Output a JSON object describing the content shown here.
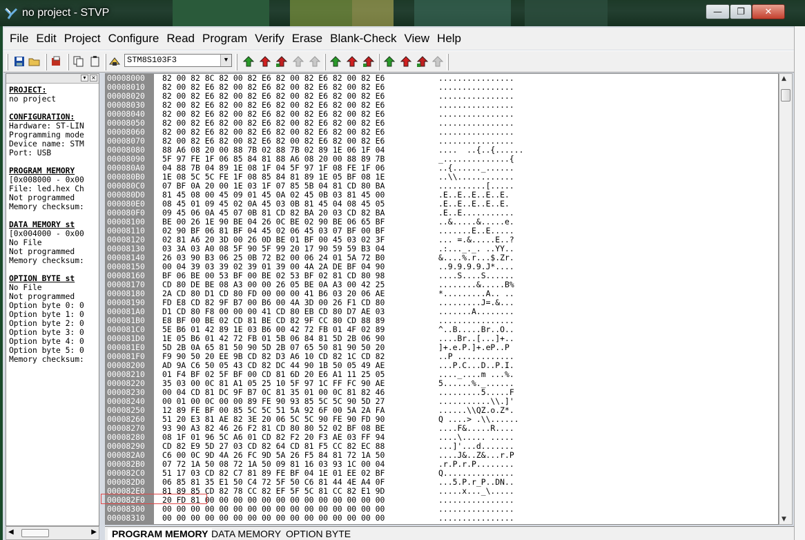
{
  "window": {
    "title": "no project - STVP",
    "min": "—",
    "max": "❐",
    "close": "✕"
  },
  "menu": [
    "File",
    "Edit",
    "Project",
    "Configure",
    "Read",
    "Program",
    "Verify",
    "Erase",
    "Blank-Check",
    "View",
    "Help"
  ],
  "toolbar": {
    "device": "STM8S103F3"
  },
  "left_panel": [
    {
      "t": "PROJECT:",
      "h": true
    },
    {
      "t": "no project"
    },
    {
      "t": ""
    },
    {
      "t": "CONFIGURATION:",
      "h": true
    },
    {
      "t": "Hardware: ST-LIN"
    },
    {
      "t": "Programming mode"
    },
    {
      "t": "Device name: STM"
    },
    {
      "t": "Port: USB"
    },
    {
      "t": ""
    },
    {
      "t": "PROGRAM MEMORY",
      "h": true
    },
    {
      "t": "[0x008000 - 0x00"
    },
    {
      "t": "File: led.hex Ch"
    },
    {
      "t": "Not programmed"
    },
    {
      "t": "Memory checksum:"
    },
    {
      "t": ""
    },
    {
      "t": "DATA MEMORY st",
      "h": true
    },
    {
      "t": "[0x004000 - 0x00"
    },
    {
      "t": "No File"
    },
    {
      "t": "Not programmed"
    },
    {
      "t": "Memory checksum:"
    },
    {
      "t": ""
    },
    {
      "t": "OPTION BYTE st",
      "h": true
    },
    {
      "t": "No File"
    },
    {
      "t": "Not programmed"
    },
    {
      "t": "Option byte 0: 0"
    },
    {
      "t": "Option byte 1: 0"
    },
    {
      "t": "Option byte 2: 0"
    },
    {
      "t": "Option byte 3: 0"
    },
    {
      "t": "Option byte 4: 0"
    },
    {
      "t": "Option byte 5: 0"
    },
    {
      "t": "Memory checksum:"
    }
  ],
  "hex_rows": [
    {
      "a": "00008000",
      "b": "82 00 82 8C 82 00 82 E6 82 00 82 E6 82 00 82 E6",
      "s": "................"
    },
    {
      "a": "00008010",
      "b": "82 00 82 E6 82 00 82 E6 82 00 82 E6 82 00 82 E6",
      "s": "................"
    },
    {
      "a": "00008020",
      "b": "82 00 82 E6 82 00 82 E6 82 00 82 E6 82 00 82 E6",
      "s": "................"
    },
    {
      "a": "00008030",
      "b": "82 00 82 E6 82 00 82 E6 82 00 82 E6 82 00 82 E6",
      "s": "................"
    },
    {
      "a": "00008040",
      "b": "82 00 82 E6 82 00 82 E6 82 00 82 E6 82 00 82 E6",
      "s": "................"
    },
    {
      "a": "00008050",
      "b": "82 00 82 E6 82 00 82 E6 82 00 82 E6 82 00 82 E6",
      "s": "................"
    },
    {
      "a": "00008060",
      "b": "82 00 82 E6 82 00 82 E6 82 00 82 E6 82 00 82 E6",
      "s": "................"
    },
    {
      "a": "00008070",
      "b": "82 00 82 E6 82 00 82 E6 82 00 82 E6 82 00 82 E6",
      "s": "................"
    },
    {
      "a": "00008080",
      "b": "88 A6 08 20 00 88 7B 02 88 7B 02 89 1E 06 1F 04",
      "s": "....  ..{..{......"
    },
    {
      "a": "00008090",
      "b": "5F 97 FE 1F 06 85 84 81 88 A6 08 20 00 88 89 7B",
      "s": "_..............{"
    },
    {
      "a": "000080A0",
      "b": "04 88 7B 04 89 1E 08 1F 04 5F 97 1F 08 FE 1F 06",
      "s": "..{......_......"
    },
    {
      "a": "000080B0",
      "b": "1E 08 5C 5C FE 1F 08 85 84 81 89 1E 05 BF 08 1E",
      "s": "..\\\\............"
    },
    {
      "a": "000080C0",
      "b": "07 BF 0A 20 00 1E 03 1F 07 85 5B 04 81 CD 80 BA",
      "s": "..........[....."
    },
    {
      "a": "000080D0",
      "b": "81 45 08 00 45 09 01 45 0A 02 45 0B 03 81 45 00",
      "s": ".E..E..E..E..E."
    },
    {
      "a": "000080E0",
      "b": "08 45 01 09 45 02 0A 45 03 0B 81 45 04 08 45 05",
      "s": ".E..E..E..E..E."
    },
    {
      "a": "000080F0",
      "b": "09 45 06 0A 45 07 0B 81 CD 82 BA 20 03 CD 82 BA",
      "s": ".E..E..........."
    },
    {
      "a": "00008100",
      "b": "BE 00 26 1E 90 BE 04 26 0C BE 02 90 BE 06 65 BF",
      "s": "..&.....&.....e."
    },
    {
      "a": "00008110",
      "b": "02 90 BF 06 81 BF 04 45 02 06 45 03 07 BF 00 BF",
      "s": ".......E..E....."
    },
    {
      "a": "00008120",
      "b": "02 81 A6 20 3D 00 26 0D BE 01 BF 00 45 03 02 3F",
      "s": "... =.&.....E..?"
    },
    {
      "a": "00008130",
      "b": "03 3A 03 A0 08 5F 90 5F 99 20 17 90 59 59 B3 04",
      "s": ".:..._._. ..YY.."
    },
    {
      "a": "00008140",
      "b": "26 03 90 B3 06 25 0B 72 B2 00 06 24 01 5A 72 B0",
      "s": "&....%.r...$.Zr."
    },
    {
      "a": "00008150",
      "b": "00 04 39 03 39 02 39 01 39 00 4A 2A DE BF 04 90",
      "s": "..9.9.9.9.J*...."
    },
    {
      "a": "00008160",
      "b": "BF 06 BE 00 53 BF 00 BE 02 53 BF 02 81 CD 80 98",
      "s": "....S....S......"
    },
    {
      "a": "00008170",
      "b": "CD 80 DE BE 08 A3 00 00 26 05 BE 0A A3 00 42 25",
      "s": "........&.....B%"
    },
    {
      "a": "00008180",
      "b": "2A CD 80 D1 CD 80 FD 00 00 00 41 B6 03 20 06 AE",
      "s": "*.........A.. .."
    },
    {
      "a": "00008190",
      "b": "FD E8 CD 82 9F B7 00 B6 00 4A 3D 00 26 F1 CD 80",
      "s": ".........J=.&..."
    },
    {
      "a": "000081A0",
      "b": "D1 CD 80 F8 00 00 00 41 CD 80 EB CD 80 D7 AE 03",
      "s": ".......A........"
    },
    {
      "a": "000081B0",
      "b": "E8 BF 00 BE 02 CD 81 BE CD 82 9F CC 80 CD 88 89",
      "s": "................"
    },
    {
      "a": "000081C0",
      "b": "5E B6 01 42 89 1E 03 B6 00 42 72 FB 01 4F 02 89",
      "s": "^..B.....Br..O.."
    },
    {
      "a": "000081D0",
      "b": "1E 05 B6 01 42 72 FB 01 5B 06 84 81 5D 2B 06 90",
      "s": "....Br..[...]+.."
    },
    {
      "a": "000081E0",
      "b": "5D 2B 0A 65 81 50 90 5D 2B 07 65 50 81 90 50 20",
      "s": "]+.e.P.]+.eP..P "
    },
    {
      "a": "000081F0",
      "b": "F9 90 50 20 EE 9B CD 82 D3 A6 10 CD 82 1C CD 82",
      "s": "..P ............"
    },
    {
      "a": "00008200",
      "b": "AD 9A C6 50 05 43 CD 82 DC 44 90 1B 50 05 49 AE",
      "s": "...P.C...D..P.I."
    },
    {
      "a": "00008210",
      "b": "01 F4 BF 02 5F BF 00 CD 81 6D 20 E6 A1 11 25 05",
      "s": "...._....m ...%."
    },
    {
      "a": "00008220",
      "b": "35 03 00 0C 81 A1 05 25 10 5F 97 1C FF FC 90 AE",
      "s": "5......%._......"
    },
    {
      "a": "00008230",
      "b": "00 04 CD 81 DC 9F B7 0C 81 35 01 00 0C 81 82 46",
      "s": ".........5.....F"
    },
    {
      "a": "00008240",
      "b": "00 01 00 0C 00 00 89 FE 90 93 85 5C 5C 90 5D 27",
      "s": "...........\\\\.]'"
    },
    {
      "a": "00008250",
      "b": "12 89 FE BF 00 85 5C 5C 51 5A 92 6F 00 5A 2A FA",
      "s": "......\\\\QZ.o.Z*."
    },
    {
      "a": "00008260",
      "b": "51 20 E3 81 AE 82 3E 20 06 5C 5C 90 FE 90 FD 90",
      "s": "Q ....> .\\\\......"
    },
    {
      "a": "00008270",
      "b": "93 90 A3 82 46 26 F2 81 CD 80 80 52 02 BF 08 BE",
      "s": "....F&.....R...."
    },
    {
      "a": "00008280",
      "b": "08 1F 01 96 5C A6 01 CD 82 F2 20 F3 AE 03 FF 94",
      "s": "....\\..... ....."
    },
    {
      "a": "00008290",
      "b": "CD 82 E9 5D 27 03 CD 82 64 CD 81 F5 CC 82 EC 88",
      "s": "...]'...d......."
    },
    {
      "a": "000082A0",
      "b": "C6 00 0C 9D 4A 26 FC 9D 5A 26 F5 84 81 72 1A 50",
      "s": "....J&..Z&...r.P"
    },
    {
      "a": "000082B0",
      "b": "07 72 1A 50 08 72 1A 50 09 81 16 03 93 1C 00 04",
      "s": ".r.P.r.P........"
    },
    {
      "a": "000082C0",
      "b": "51 17 03 CD 82 C7 81 89 FE BF 04 1E 01 EE 02 BF",
      "s": "Q..............."
    },
    {
      "a": "000082D0",
      "b": "06 85 81 35 E1 50 C4 72 5F 50 C6 81 44 4E A4 0F",
      "s": "...5.P.r_P..DN.."
    },
    {
      "a": "000082E0",
      "b": "81 89 85 CD 82 78 CC 82 EF 5F 5C 81 CC 82 E1 9D",
      "s": ".....x..._\\....."
    },
    {
      "a": "000082F0",
      "b": "20 FD 81 00 00 00 00 00 00 00 00 00 00 00 00 00",
      "s": "................"
    },
    {
      "a": "00008300",
      "b": "00 00 00 00 00 00 00 00 00 00 00 00 00 00 00 00",
      "s": "................"
    },
    {
      "a": "00008310",
      "b": "00 00 00 00 00 00 00 00 00 00 00 00 00 00 00 00",
      "s": "................"
    }
  ],
  "tabs": [
    "PROGRAM MEMORY",
    "DATA MEMORY",
    "OPTION BYTE"
  ]
}
